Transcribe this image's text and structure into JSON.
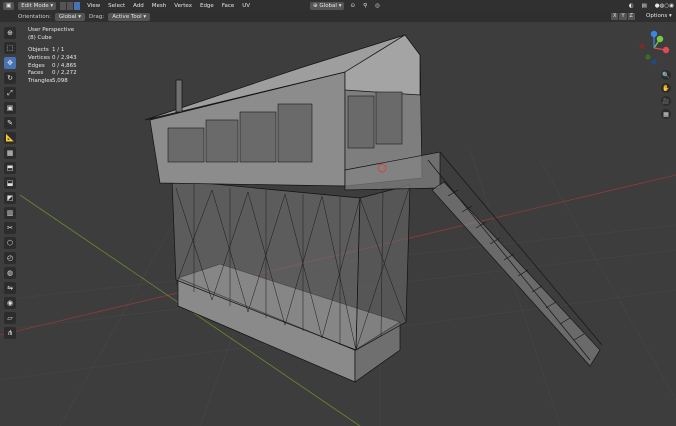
{
  "header": {
    "mode": "Edit Mode",
    "menu": [
      "View",
      "Select",
      "Add",
      "Mesh",
      "Vertex",
      "Edge",
      "Face",
      "UV"
    ],
    "transform_orientation": "Global",
    "icons": [
      "editor-type-icon",
      "vertex-select-icon",
      "edge-select-icon",
      "face-select-icon",
      "pivot-icon",
      "snap-icon",
      "proportional-icon",
      "viewport-shading-icon"
    ]
  },
  "subheader": {
    "orientation_label": "Orientation:",
    "orientation_value": "Global",
    "drag_label": "Drag:",
    "drag_value": "Active Tool",
    "options": "Options",
    "axes": [
      "X",
      "Y",
      "Z"
    ]
  },
  "toolbar": {
    "icons": [
      "cursor-tool-icon",
      "select-box-tool-icon",
      "move-tool-icon",
      "rotate-tool-icon",
      "scale-tool-icon",
      "transform-tool-icon",
      "annotate-tool-icon",
      "measure-tool-icon",
      "add-cube-tool-icon",
      "extrude-tool-icon",
      "inset-tool-icon",
      "bevel-tool-icon",
      "loop-cut-tool-icon",
      "knife-tool-icon",
      "poly-build-tool-icon",
      "spin-tool-icon",
      "smooth-tool-icon",
      "edge-slide-tool-icon",
      "shrink-fatten-tool-icon",
      "shear-tool-icon",
      "rip-tool-icon"
    ],
    "active_index": 2
  },
  "viewport": {
    "view_name": "User Perspective",
    "object_name": "(8) Cube",
    "stats": [
      {
        "label": "Objects",
        "value": "1 / 1"
      },
      {
        "label": "Vertices",
        "value": "0 / 2,943"
      },
      {
        "label": "Edges",
        "value": "0 / 4,865"
      },
      {
        "label": "Faces",
        "value": "0 / 2,272"
      },
      {
        "label": "Triangles",
        "value": "5,098"
      }
    ]
  },
  "gizmo": {
    "axes": [
      "X",
      "Y",
      "Z"
    ],
    "colors": {
      "x": "#e24a53",
      "y": "#7ac943",
      "z": "#3b87e8"
    }
  },
  "nav_icons": [
    "zoom-icon",
    "pan-hand-icon",
    "camera-view-icon",
    "ortho-toggle-icon"
  ],
  "colors": {
    "background": "#3d3d3d",
    "grid": "#464646",
    "x_axis": "#9a3b3b",
    "y_axis": "#6c8a2d",
    "accent": "#4772b3",
    "wire": "#0a0a0a",
    "mesh": "#7a7a7a"
  }
}
